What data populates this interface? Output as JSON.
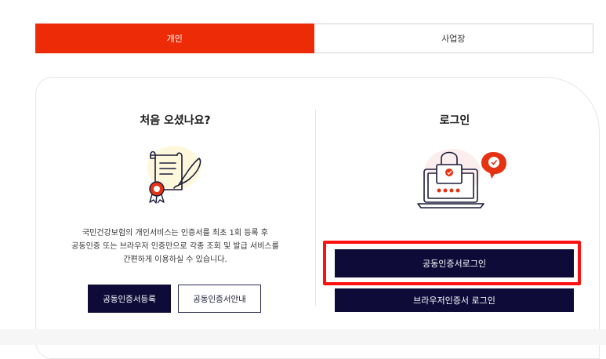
{
  "tabs": {
    "personal": "개인",
    "business": "사업장"
  },
  "left": {
    "title": "처음 오셨나요?",
    "description": [
      "국민건강보험의 개인서비스는 인증서를 최초 1회 등록 후",
      "공동인증 또는 브라우저 인증만으로 각종 조회 및 발급 서비스를",
      "간편하게 이용하실 수 있습니다."
    ],
    "register_button": "공동인증서등록",
    "guide_button": "공동인증서안내"
  },
  "right": {
    "title": "로그인",
    "joint_login_button": "공동인증서로그인",
    "browser_login_button": "브라우저인증서 로그인"
  },
  "colors": {
    "accent": "#ee2b07",
    "navy": "#0e0b38",
    "highlight": "#ff1010"
  }
}
